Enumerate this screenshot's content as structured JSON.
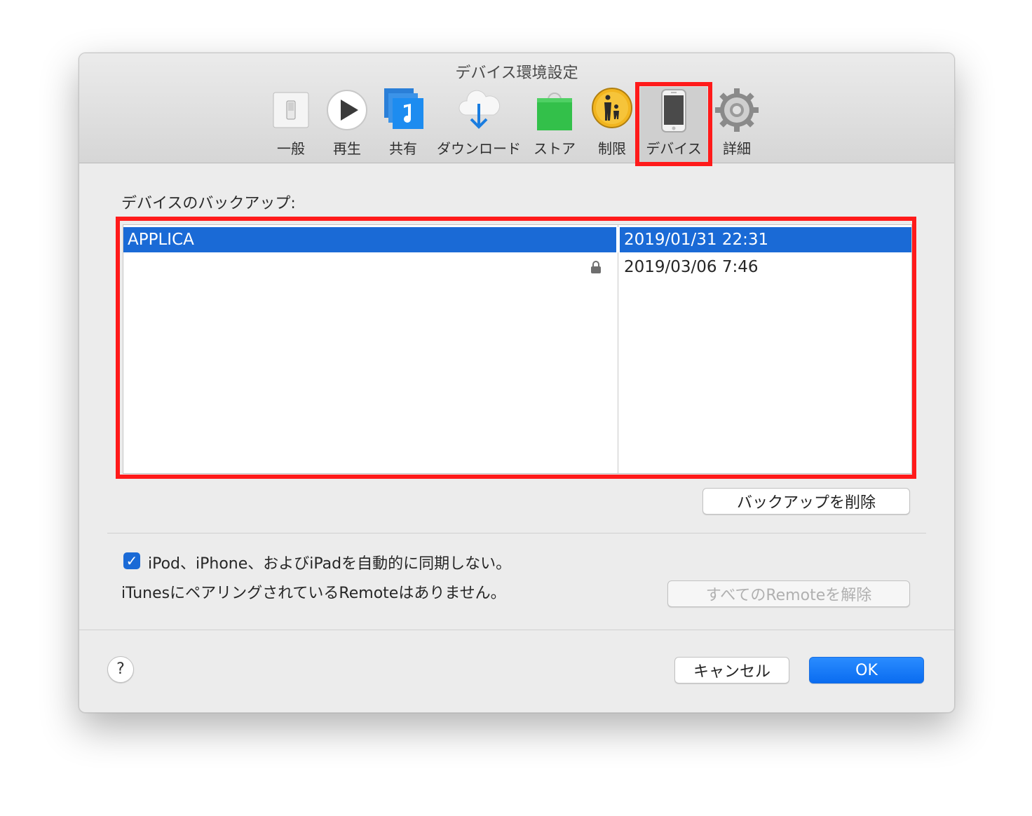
{
  "window": {
    "title": "デバイス環境設定"
  },
  "toolbar": {
    "items": [
      {
        "label": "一般",
        "icon": "switch-icon"
      },
      {
        "label": "再生",
        "icon": "play-icon"
      },
      {
        "label": "共有",
        "icon": "music-share-icon"
      },
      {
        "label": "ダウンロード",
        "icon": "cloud-download-icon"
      },
      {
        "label": "ストア",
        "icon": "shopping-bag-icon"
      },
      {
        "label": "制限",
        "icon": "parental-controls-icon"
      },
      {
        "label": "デバイス",
        "icon": "iphone-icon",
        "selected": true
      },
      {
        "label": "詳細",
        "icon": "gear-icon"
      }
    ]
  },
  "backups": {
    "label": "デバイスのバックアップ:",
    "rows": [
      {
        "name": "APPLICA",
        "date": "2019/01/31 22:31",
        "selected": true,
        "locked": false
      },
      {
        "name": "",
        "date": "2019/03/06 7:46",
        "selected": false,
        "locked": true
      }
    ],
    "delete_button": "バックアップを削除"
  },
  "sync": {
    "checkbox_label": "iPod、iPhone、およびiPadを自動的に同期しない。",
    "checked": true
  },
  "remote": {
    "status_text": "iTunesにペアリングされているRemoteはありません。",
    "remove_button": "すべてのRemoteを解除"
  },
  "footer": {
    "help": "?",
    "cancel": "キャンセル",
    "ok": "OK"
  },
  "colors": {
    "selection": "#1a6ad6",
    "highlight": "#ff1a1a",
    "primary": "#0a6cf0"
  }
}
